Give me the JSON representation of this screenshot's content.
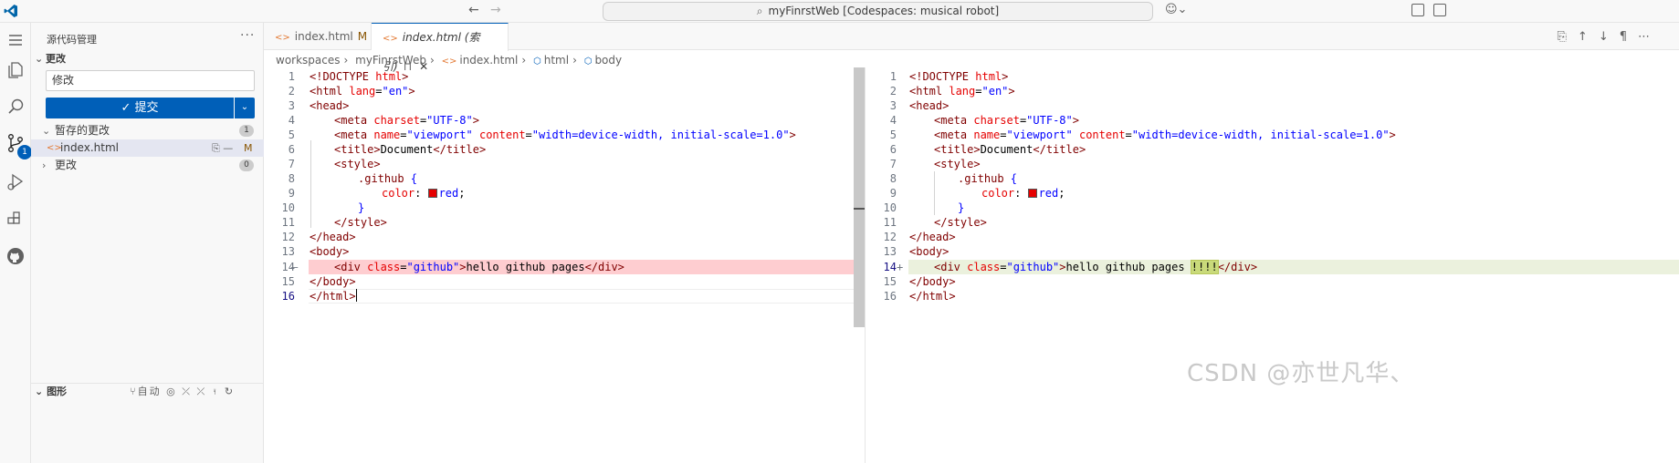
{
  "titlebar": {
    "search_text": "myFinrstWeb [Codespaces: musical robot]"
  },
  "activity": {
    "badge": "1"
  },
  "sidebar": {
    "title": "源代码管理",
    "more": "···",
    "changes_section": "更改",
    "commit_message": "修改",
    "commit_button": "✓ 提交",
    "staged_label": "暂存的更改",
    "staged_count": "1",
    "staged_file": "index.html",
    "staged_file_status": "M",
    "changes_label": "更改",
    "changes_count": "0",
    "graph_label": "图形",
    "graph_auto": "自动"
  },
  "tabs": [
    {
      "label": "index.html",
      "status": "M"
    },
    {
      "label": "index.html (索引)"
    }
  ],
  "breadcrumb": [
    "workspaces",
    "myFinrstWeb",
    "index.html",
    "html",
    "body"
  ],
  "left_editor": {
    "line_numbers": [
      "1",
      "2",
      "3",
      "4",
      "5",
      "6",
      "7",
      "8",
      "9",
      "10",
      "11",
      "12",
      "13",
      "14",
      "15",
      "16"
    ],
    "line14_marker": "—"
  },
  "right_editor": {
    "line_numbers": [
      "1",
      "2",
      "3",
      "4",
      "5",
      "6",
      "7",
      "8",
      "9",
      "10",
      "11",
      "12",
      "13",
      "14",
      "15",
      "16"
    ],
    "line14_marker": "+"
  },
  "code": {
    "l1_a": "<!DOCTYPE ",
    "l1_b": "html",
    "l1_c": ">",
    "l2_a": "<html ",
    "l2_b": "lang",
    "l2_c": "=",
    "l2_d": "\"en\"",
    "l2_e": ">",
    "l3": "<head>",
    "l4_a": "<meta ",
    "l4_b": "charset",
    "l4_c": "=",
    "l4_d": "\"UTF-8\"",
    "l4_e": ">",
    "l5_a": "<meta ",
    "l5_b": "name",
    "l5_c": "=",
    "l5_d": "\"viewport\"",
    "l5_e": " content",
    "l5_f": "=",
    "l5_g": "\"width=device-width, initial-scale=1.0\"",
    "l5_h": ">",
    "l6_a": "<title>",
    "l6_b": "Document",
    "l6_c": "</title>",
    "l7": "<style>",
    "l8_a": ".github",
    "l8_b": " {",
    "l9_a": "color",
    "l9_b": ": ",
    "l9_c": "red",
    "l9_d": ";",
    "l10": "}",
    "l11": "</style>",
    "l12": "</head>",
    "l13": "<body>",
    "l14_a": "<div ",
    "l14_b": "class",
    "l14_c": "=",
    "l14_d": "\"github\"",
    "l14_e": ">",
    "l14_f": "hello github pages",
    "l14_g": "</div>",
    "l14_ins": "!!!!",
    "l15": "</body>",
    "l16": "</html>"
  },
  "watermark": "CSDN @亦世凡华、"
}
